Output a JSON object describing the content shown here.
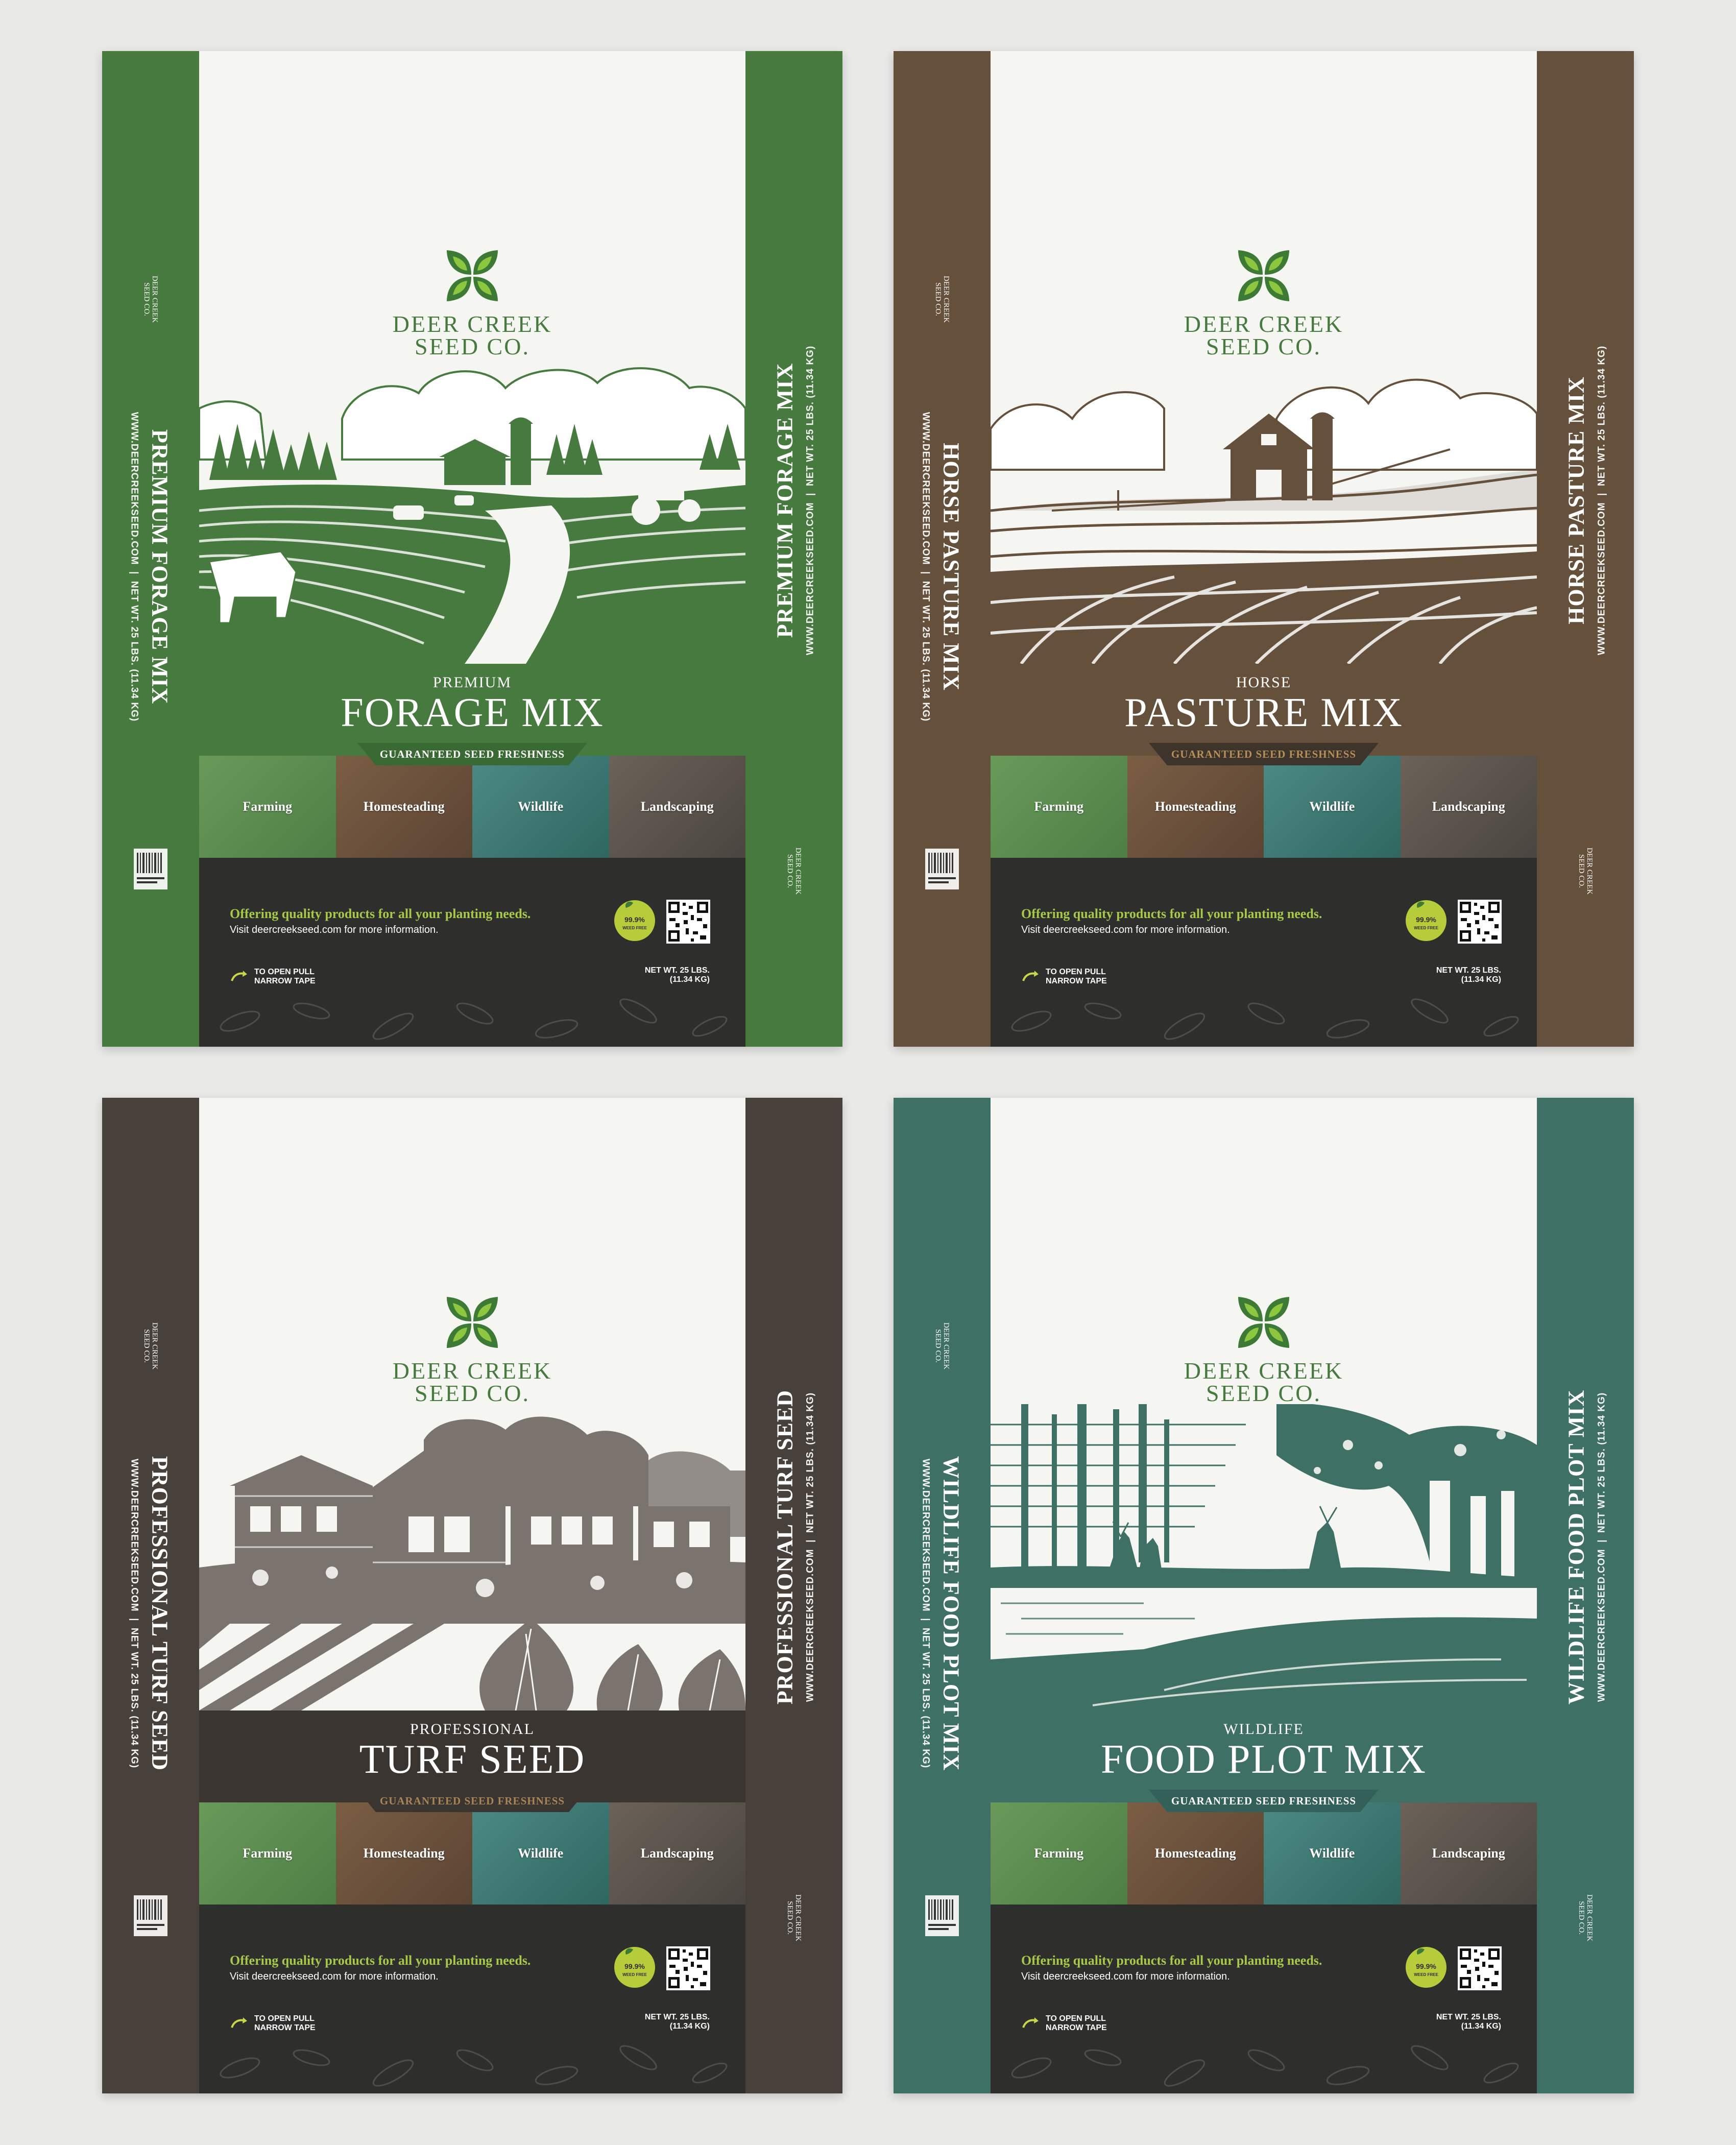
{
  "brand": {
    "line1": "DEER CREEK",
    "line2": "SEED CO."
  },
  "common": {
    "website": "WWW.DEERCREEKSEED.COM",
    "net_wt_vertical": "NET WT. 25 LBS. (11.34 KG)",
    "fresh": "GUARANTEED SEED FRESHNESS",
    "tiles": [
      "Farming",
      "Homesteading",
      "Wildlife",
      "Landscaping"
    ],
    "offer": "Offering quality products for all your planting needs.",
    "visit": "Visit deercreekseed.com for more information.",
    "open_line1": "TO OPEN PULL",
    "open_line2": "NARROW TAPE",
    "net_line1": "NET WT. 25 LBS.",
    "net_line2": "(11.34 KG)",
    "seal_line1": "99.9%",
    "seal_line2": "WEED FREE",
    "small_logo_line1": "DEER CREEK",
    "small_logo_line2": "SEED CO.",
    "barcode_text": "PAPER/CORRUGATED"
  },
  "bags": [
    {
      "small": "PREMIUM",
      "big": "FORAGE MIX",
      "vertical": "PREMIUM FORAGE MIX",
      "colors": {
        "side": "#467a3e",
        "ink": "#467a3e",
        "banner": "#3a6a33",
        "banner_text": "#ffffff"
      }
    },
    {
      "small": "HORSE",
      "big": "PASTURE MIX",
      "vertical": "HORSE PASTURE MIX",
      "colors": {
        "side": "#65503b",
        "ink": "#65503b",
        "banner": "#3d342c",
        "banner_text": "#b88f58"
      }
    },
    {
      "small": "PROFESSIONAL",
      "big": "TURF SEED",
      "vertical": "PROFESSIONAL TURF SEED",
      "colors": {
        "side": "#48413b",
        "ink": "#7b736e",
        "banner": "#3a3531",
        "banner_text": "#a98556"
      }
    },
    {
      "small": "WILDLIFE",
      "big": "FOOD PLOT MIX",
      "vertical": "WILDLIFE FOOD PLOT MIX",
      "colors": {
        "side": "#3f7065",
        "ink": "#3f7065",
        "banner": "#33615a",
        "banner_text": "#ffffff"
      }
    }
  ],
  "accent": {
    "leaf_dark": "#3c7a36",
    "leaf_light": "#8dc63f",
    "offer_green": "#a6c94a",
    "seal": "#b7cc3a"
  }
}
